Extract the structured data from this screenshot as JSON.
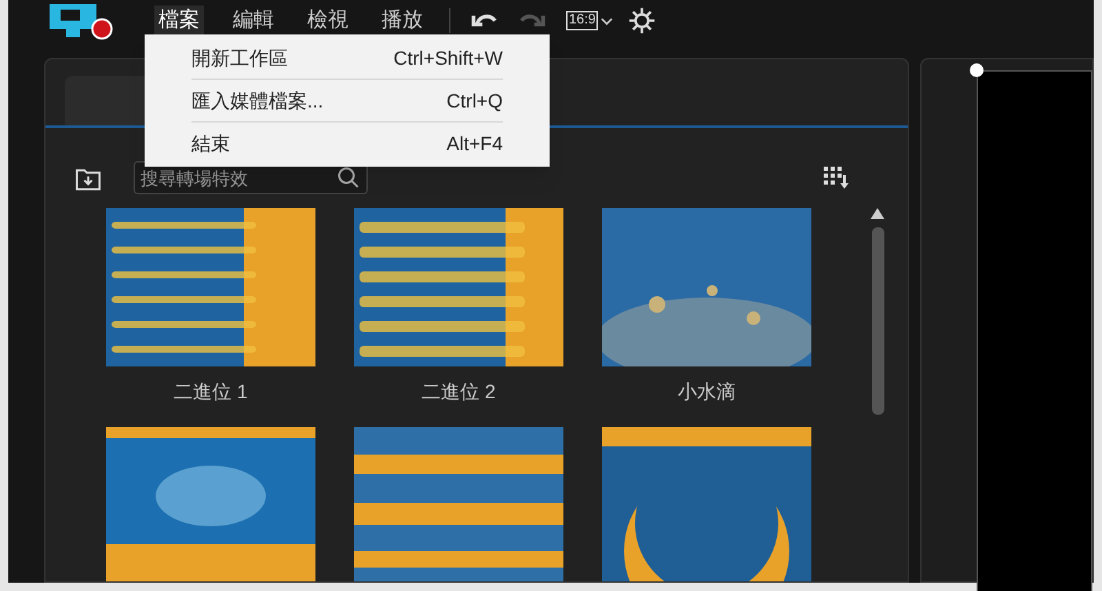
{
  "menu_bar": [
    {
      "label": "檔案",
      "selected": true
    },
    {
      "label": "編輯",
      "selected": false
    },
    {
      "label": "檢視",
      "selected": false
    },
    {
      "label": "播放",
      "selected": false
    }
  ],
  "toolbar": {
    "aspect_ratio": "16:9"
  },
  "dropdown": [
    {
      "label": "開新工作區",
      "shortcut": "Ctrl+Shift+W"
    },
    {
      "label": "匯入媒體檔案...",
      "shortcut": "Ctrl+Q"
    },
    {
      "label": "結束",
      "shortcut": "Alt+F4"
    }
  ],
  "search": {
    "placeholder": "搜尋轉場特效"
  },
  "transitions": [
    {
      "label": "二進位 1",
      "kind": "binary"
    },
    {
      "label": "二進位 2",
      "kind": "binary"
    },
    {
      "label": "小水滴",
      "kind": "drops"
    },
    {
      "kind": "wave"
    },
    {
      "kind": "blur"
    },
    {
      "kind": "moon"
    }
  ]
}
